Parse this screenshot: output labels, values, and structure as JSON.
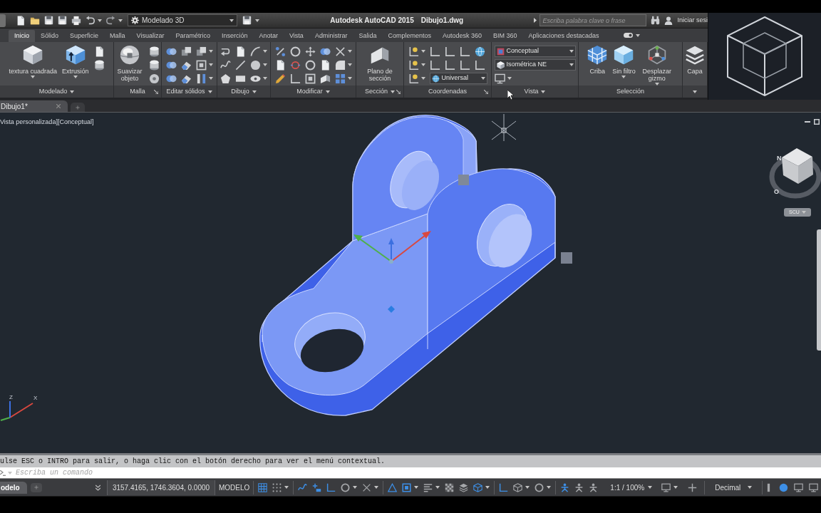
{
  "title_bar": {
    "workspace": "Modelado 3D",
    "title": "Autodesk AutoCAD 2015",
    "file_name": "Dibujo1.dwg",
    "search": {
      "placeholder": "Escriba palabra clave o frase"
    },
    "sign_in": "Iniciar sesi"
  },
  "ribbon_tabs": [
    {
      "label": "Inicio",
      "selected": true
    },
    {
      "label": "Sólido",
      "selected": false
    },
    {
      "label": "Superficie",
      "selected": false
    },
    {
      "label": "Malla",
      "selected": false
    },
    {
      "label": "Visualizar",
      "selected": false
    },
    {
      "label": "Paramétrico",
      "selected": false
    },
    {
      "label": "Inserción",
      "selected": false
    },
    {
      "label": "Anotar",
      "selected": false
    },
    {
      "label": "Vista",
      "selected": false
    },
    {
      "label": "Administrar",
      "selected": false
    },
    {
      "label": "Salida",
      "selected": false
    },
    {
      "label": "Complementos",
      "selected": false
    },
    {
      "label": "Autodesk 360",
      "selected": false
    },
    {
      "label": "BIM 360",
      "selected": false
    },
    {
      "label": "Aplicaciones destacadas",
      "selected": false
    }
  ],
  "ribbon_panels": [
    {
      "title": "Modelado",
      "menu": true,
      "launcher": false,
      "tools": [
        {
          "kind": "large",
          "label": "textura cuadrada",
          "menu": true
        },
        {
          "kind": "large",
          "label": "Extrusión",
          "menu": true
        },
        {
          "kind": "rows",
          "rows": [
            [
              {
                "kind": "small",
                "menu": false
              }
            ],
            [
              {
                "kind": "small",
                "menu": false
              }
            ]
          ]
        }
      ]
    },
    {
      "title": "Malla",
      "menu": false,
      "launcher": true,
      "tools": [
        {
          "kind": "large",
          "label": "Suavizar objeto",
          "menu": false
        },
        {
          "kind": "rows",
          "rows": [
            [
              {
                "kind": "small",
                "menu": false
              }
            ],
            [
              {
                "kind": "small",
                "menu": false
              }
            ],
            [
              {
                "kind": "small",
                "menu": false
              }
            ]
          ]
        }
      ]
    },
    {
      "title": "Editar sólidos",
      "menu": true,
      "launcher": false,
      "tools": [
        {
          "kind": "rows",
          "rows": [
            [
              {
                "kind": "small",
                "menu": false
              },
              {
                "kind": "small",
                "menu": false
              },
              {
                "kind": "small",
                "menu": true
              }
            ],
            [
              {
                "kind": "small",
                "menu": false
              },
              {
                "kind": "small",
                "menu": false
              },
              {
                "kind": "small",
                "menu": true
              }
            ],
            [
              {
                "kind": "small",
                "menu": false
              },
              {
                "kind": "small",
                "menu": false
              },
              {
                "kind": "small",
                "menu": true
              }
            ]
          ]
        }
      ]
    },
    {
      "title": "Dibujo",
      "menu": true,
      "launcher": false,
      "tools": [
        {
          "kind": "rows",
          "rows": [
            [
              {
                "kind": "small",
                "menu": false
              },
              {
                "kind": "small",
                "menu": false
              },
              {
                "kind": "small",
                "menu": true
              }
            ],
            [
              {
                "kind": "small",
                "menu": false
              },
              {
                "kind": "small",
                "menu": false
              },
              {
                "kind": "small",
                "menu": true
              }
            ],
            [
              {
                "kind": "small",
                "menu": false
              },
              {
                "kind": "small",
                "menu": false
              },
              {
                "kind": "small",
                "menu": true
              }
            ]
          ]
        }
      ]
    },
    {
      "title": "Modificar",
      "menu": true,
      "launcher": false,
      "tools": [
        {
          "kind": "rows",
          "rows": [
            [
              {
                "kind": "small",
                "menu": false
              },
              {
                "kind": "small",
                "menu": false
              },
              {
                "kind": "small",
                "menu": false
              },
              {
                "kind": "small",
                "menu": false
              },
              {
                "kind": "small",
                "menu": true
              }
            ],
            [
              {
                "kind": "small",
                "menu": false
              },
              {
                "kind": "small",
                "menu": false
              },
              {
                "kind": "small",
                "menu": false
              },
              {
                "kind": "small",
                "menu": false
              },
              {
                "kind": "small",
                "menu": true
              }
            ],
            [
              {
                "kind": "small",
                "menu": false
              },
              {
                "kind": "small",
                "menu": false
              },
              {
                "kind": "small",
                "menu": false
              },
              {
                "kind": "small",
                "menu": false
              },
              {
                "kind": "small",
                "menu": true
              }
            ]
          ]
        }
      ]
    },
    {
      "title": "Sección",
      "menu": true,
      "launcher": true,
      "tools": [
        {
          "kind": "large",
          "label": "Plano de sección",
          "menu": false
        }
      ]
    },
    {
      "title": "Coordenadas",
      "menu": false,
      "launcher": true,
      "tools": [
        {
          "kind": "rows",
          "rows": [
            [
              {
                "kind": "small",
                "menu": true
              },
              {
                "kind": "small",
                "menu": false
              },
              {
                "kind": "small",
                "menu": false
              },
              {
                "kind": "small",
                "menu": false
              },
              {
                "kind": "small",
                "menu": false
              }
            ],
            [
              {
                "kind": "small",
                "menu": true
              },
              {
                "kind": "small",
                "menu": false
              },
              {
                "kind": "small",
                "menu": false
              },
              {
                "kind": "small",
                "menu": false
              },
              {
                "kind": "small",
                "menu": false
              }
            ],
            [
              {
                "kind": "small",
                "menu": true
              },
              {
                "kind": "dropdown",
                "value": "Universal"
              }
            ]
          ]
        }
      ]
    },
    {
      "title": "Vista",
      "menu": true,
      "launcher": false,
      "tools": [
        {
          "kind": "rows",
          "rows": [
            [
              {
                "kind": "dropdown",
                "value": "Conceptual"
              }
            ],
            [
              {
                "kind": "dropdown",
                "value": "Isométrica NE"
              }
            ],
            [
              {
                "kind": "small",
                "menu": true
              }
            ]
          ]
        }
      ]
    },
    {
      "title": "Selección",
      "menu": false,
      "launcher": false,
      "tools": [
        {
          "kind": "large",
          "label": "Criba",
          "menu": false
        },
        {
          "kind": "large",
          "label": "Sin filtro",
          "menu": true
        },
        {
          "kind": "large",
          "label": "Desplazar gizmo",
          "menu": true
        }
      ]
    },
    {
      "menu": true,
      "launcher": false,
      "tools": [
        {
          "kind": "large",
          "label": "Capa",
          "menu": false
        }
      ]
    }
  ],
  "document_tabs": [
    {
      "label": "Dibujo1*",
      "selected": true
    }
  ],
  "viewport": {
    "label": "Vista personalizada][Conceptual]",
    "ucs_labels": [
      "Z",
      "X"
    ],
    "compass_labels": [
      "N",
      "O"
    ],
    "ucs_menu": "SCU"
  },
  "command_line": {
    "history": "ulse ESC o INTRO para salir, o haga clic con el botón derecho para ver el menú contextual.",
    "input": {
      "placeholder": "Escriba un comando"
    }
  },
  "status_bar": {
    "layout_tabs": [
      {
        "label": "odelo",
        "selected": true
      }
    ],
    "coordinates": "3157.4165, 1746.3604, 0.0000",
    "space": "MODELO",
    "toggle_groups": [
      [
        {
          "on": true,
          "menu": false
        },
        {
          "on": false,
          "menu": true
        }
      ],
      [
        {
          "on": true,
          "menu": false
        },
        {
          "on": true,
          "menu": false
        },
        {
          "on": true,
          "menu": false
        },
        {
          "on": false,
          "menu": true
        },
        {
          "on": false,
          "menu": true
        }
      ],
      [
        {
          "on": true,
          "menu": false
        },
        {
          "on": true,
          "menu": true
        },
        {
          "on": false,
          "menu": true
        },
        {
          "on": false,
          "menu": false
        },
        {
          "on": false,
          "menu": false
        },
        {
          "on": true,
          "menu": true
        }
      ],
      [
        {
          "on": true,
          "menu": false
        },
        {
          "on": false,
          "menu": true
        },
        {
          "on": false,
          "menu": true
        }
      ],
      [
        {
          "on": true,
          "menu": false
        },
        {
          "on": false,
          "menu": false
        },
        {
          "on": false,
          "menu": false
        }
      ]
    ],
    "scale": "1:1 / 100%",
    "scale_tools": [
      {
        "on": false,
        "menu": true
      },
      {
        "on": false,
        "menu": false
      }
    ],
    "units": "Decimal",
    "unit_tools": [
      {
        "on": false,
        "menu": false
      },
      {
        "on": true,
        "menu": false
      },
      {
        "on": false,
        "menu": false
      },
      {
        "on": false,
        "menu": false
      }
    ]
  }
}
